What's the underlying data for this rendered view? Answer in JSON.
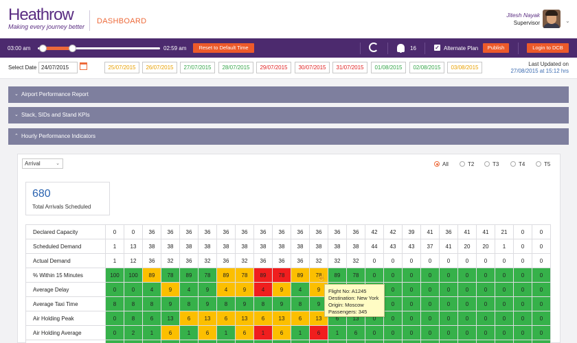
{
  "header": {
    "brand": "Heathrow",
    "tagline": "Making every journey better",
    "section_title": "DASHBOARD",
    "user_name": "Jitesh Nayak",
    "user_role": "Supervisor"
  },
  "toolbar": {
    "time_start": "03:00 am",
    "time_end": "02:59 am",
    "reset_label": "Reset to Default Time",
    "alert_count": "16",
    "alternate_plan_label": "Alternate Plan",
    "alternate_plan_checked": true,
    "publish_label": "Publish",
    "login_label": "Login to DCB"
  },
  "datebar": {
    "select_date_label": "Select Date",
    "selected_date": "24/07/2015",
    "dates": [
      {
        "label": "25/07/2015",
        "color": "#e8a000"
      },
      {
        "label": "26/07/2015",
        "color": "#e8a000"
      },
      {
        "label": "27/07/2015",
        "color": "#36a64a"
      },
      {
        "label": "28/07/2015",
        "color": "#36a64a"
      },
      {
        "label": "29/07/2015",
        "color": "#e02020"
      },
      {
        "label": "30/07/2015",
        "color": "#e02020"
      },
      {
        "label": "31/07/2015",
        "color": "#e02020"
      },
      {
        "label": "01/08/2015",
        "color": "#36a64a"
      },
      {
        "label": "02/08/2015",
        "color": "#36a64a"
      },
      {
        "label": "03/08/2015",
        "color": "#e8a000"
      }
    ],
    "last_updated_label": "Last Updated on",
    "last_updated_value": "27/08/2015 at 15:12 hrs"
  },
  "sections": [
    {
      "label": "Airport Performance Report",
      "chevron": "down-chevron-icon"
    },
    {
      "label": "Stack, SIDs and Stand KPIs",
      "chevron": "down-chevron-icon"
    },
    {
      "label": "Hourly Performance Indicators",
      "chevron": "up-chevron-icon"
    }
  ],
  "hourly": {
    "direction_select": "Arrival",
    "terminals": [
      {
        "label": "All",
        "selected": true
      },
      {
        "label": "T2",
        "selected": false
      },
      {
        "label": "T3",
        "selected": false
      },
      {
        "label": "T4",
        "selected": false
      },
      {
        "label": "T5",
        "selected": false
      }
    ],
    "total_value": "680",
    "total_label": "Total Arrivals Scheduled",
    "rows": [
      {
        "label": "Declared Capacity",
        "values": [
          "0",
          "0",
          "36",
          "36",
          "36",
          "36",
          "36",
          "36",
          "36",
          "36",
          "36",
          "36",
          "36",
          "36",
          "42",
          "42",
          "39",
          "41",
          "36",
          "41",
          "41",
          "21",
          "0",
          "0"
        ],
        "colors": [
          "",
          "",
          "",
          "",
          "",
          "",
          "",
          "",
          "",
          "",
          "",
          "",
          "",
          "",
          "",
          "",
          "",
          "",
          "",
          "",
          "",
          "",
          "",
          ""
        ]
      },
      {
        "label": "Scheduled Demand",
        "values": [
          "1",
          "13",
          "38",
          "38",
          "38",
          "38",
          "38",
          "38",
          "38",
          "38",
          "38",
          "38",
          "38",
          "38",
          "44",
          "43",
          "43",
          "37",
          "41",
          "20",
          "20",
          "1",
          "0",
          "0"
        ],
        "colors": [
          "",
          "",
          "",
          "",
          "",
          "",
          "",
          "",
          "",
          "",
          "",
          "",
          "",
          "",
          "",
          "",
          "",
          "",
          "",
          "",
          "",
          "",
          "",
          ""
        ]
      },
      {
        "label": "Actual Demand",
        "values": [
          "1",
          "12",
          "36",
          "32",
          "36",
          "32",
          "36",
          "32",
          "36",
          "36",
          "36",
          "32",
          "32",
          "32",
          "0",
          "0",
          "0",
          "0",
          "0",
          "0",
          "0",
          "0",
          "0",
          "0"
        ],
        "colors": [
          "",
          "",
          "",
          "",
          "",
          "",
          "",
          "",
          "",
          "",
          "",
          "",
          "",
          "",
          "",
          "",
          "",
          "",
          "",
          "",
          "",
          "",
          "",
          ""
        ]
      },
      {
        "label": "% Within 15 Minutes",
        "values": [
          "100",
          "100",
          "89",
          "78",
          "89",
          "78",
          "89",
          "78",
          "89",
          "78",
          "89",
          "78",
          "89",
          "78",
          "0",
          "0",
          "0",
          "0",
          "0",
          "0",
          "0",
          "0",
          "0",
          "0"
        ],
        "colors": [
          "g",
          "g",
          "y",
          "g",
          "g",
          "g",
          "y",
          "y",
          "r",
          "r",
          "y",
          "y",
          "g",
          "g",
          "g",
          "g",
          "g",
          "g",
          "g",
          "g",
          "g",
          "g",
          "g",
          "g"
        ]
      },
      {
        "label": "Average Delay",
        "values": [
          "0",
          "0",
          "4",
          "9",
          "4",
          "9",
          "4",
          "9",
          "4",
          "9",
          "4",
          "9",
          "4",
          "9",
          "0",
          "0",
          "0",
          "0",
          "0",
          "0",
          "0",
          "0",
          "0",
          "0"
        ],
        "colors": [
          "g",
          "g",
          "g",
          "y",
          "g",
          "g",
          "y",
          "y",
          "r",
          "y",
          "g",
          "y",
          "g",
          "g",
          "g",
          "g",
          "g",
          "g",
          "g",
          "g",
          "g",
          "g",
          "g",
          "g"
        ]
      },
      {
        "label": "Average Taxi Time",
        "values": [
          "8",
          "8",
          "8",
          "9",
          "8",
          "9",
          "8",
          "9",
          "8",
          "9",
          "8",
          "9",
          "8",
          "9",
          "0",
          "0",
          "0",
          "0",
          "0",
          "0",
          "0",
          "0",
          "0",
          "0"
        ],
        "colors": [
          "g",
          "g",
          "g",
          "g",
          "g",
          "g",
          "g",
          "g",
          "g",
          "g",
          "g",
          "g",
          "g",
          "g",
          "g",
          "g",
          "g",
          "g",
          "g",
          "g",
          "g",
          "g",
          "g",
          "g"
        ]
      },
      {
        "label": "Air Holding Peak",
        "values": [
          "0",
          "8",
          "6",
          "13",
          "6",
          "13",
          "6",
          "13",
          "6",
          "13",
          "6",
          "13",
          "6",
          "13",
          "0",
          "0",
          "0",
          "0",
          "0",
          "0",
          "0",
          "0",
          "0",
          "0"
        ],
        "colors": [
          "g",
          "g",
          "g",
          "g",
          "y",
          "y",
          "y",
          "y",
          "y",
          "y",
          "y",
          "y",
          "g",
          "g",
          "g",
          "g",
          "g",
          "g",
          "g",
          "g",
          "g",
          "g",
          "g",
          "g"
        ]
      },
      {
        "label": "Air Holding Average",
        "values": [
          "0",
          "2",
          "1",
          "6",
          "1",
          "6",
          "1",
          "6",
          "1",
          "6",
          "1",
          "6",
          "1",
          "6",
          "0",
          "0",
          "0",
          "0",
          "0",
          "0",
          "0",
          "0",
          "0",
          "0"
        ],
        "colors": [
          "g",
          "g",
          "g",
          "y",
          "g",
          "y",
          "g",
          "y",
          "r",
          "y",
          "g",
          "r",
          "g",
          "g",
          "g",
          "g",
          "g",
          "g",
          "g",
          "g",
          "g",
          "g",
          "g",
          "g"
        ]
      },
      {
        "label": "",
        "values": [
          "",
          "",
          "",
          "",
          "",
          "",
          "",
          "",
          "",
          "",
          "",
          "",
          "",
          "",
          "",
          "",
          "",
          "",
          "",
          "",
          "",
          "",
          "",
          ""
        ],
        "colors": [
          "g",
          "g",
          "g",
          "g",
          "g",
          "g",
          "g",
          "g",
          "g",
          "g",
          "g",
          "g",
          "g",
          "g",
          "g",
          "g",
          "g",
          "g",
          "g",
          "g",
          "g",
          "g",
          "g",
          "g"
        ]
      }
    ],
    "tooltip": {
      "flight": "Flight No: A1245",
      "destination": "Destination: New York",
      "origin": "Origin: Moscow",
      "passengers": "Passengers: 345"
    }
  }
}
